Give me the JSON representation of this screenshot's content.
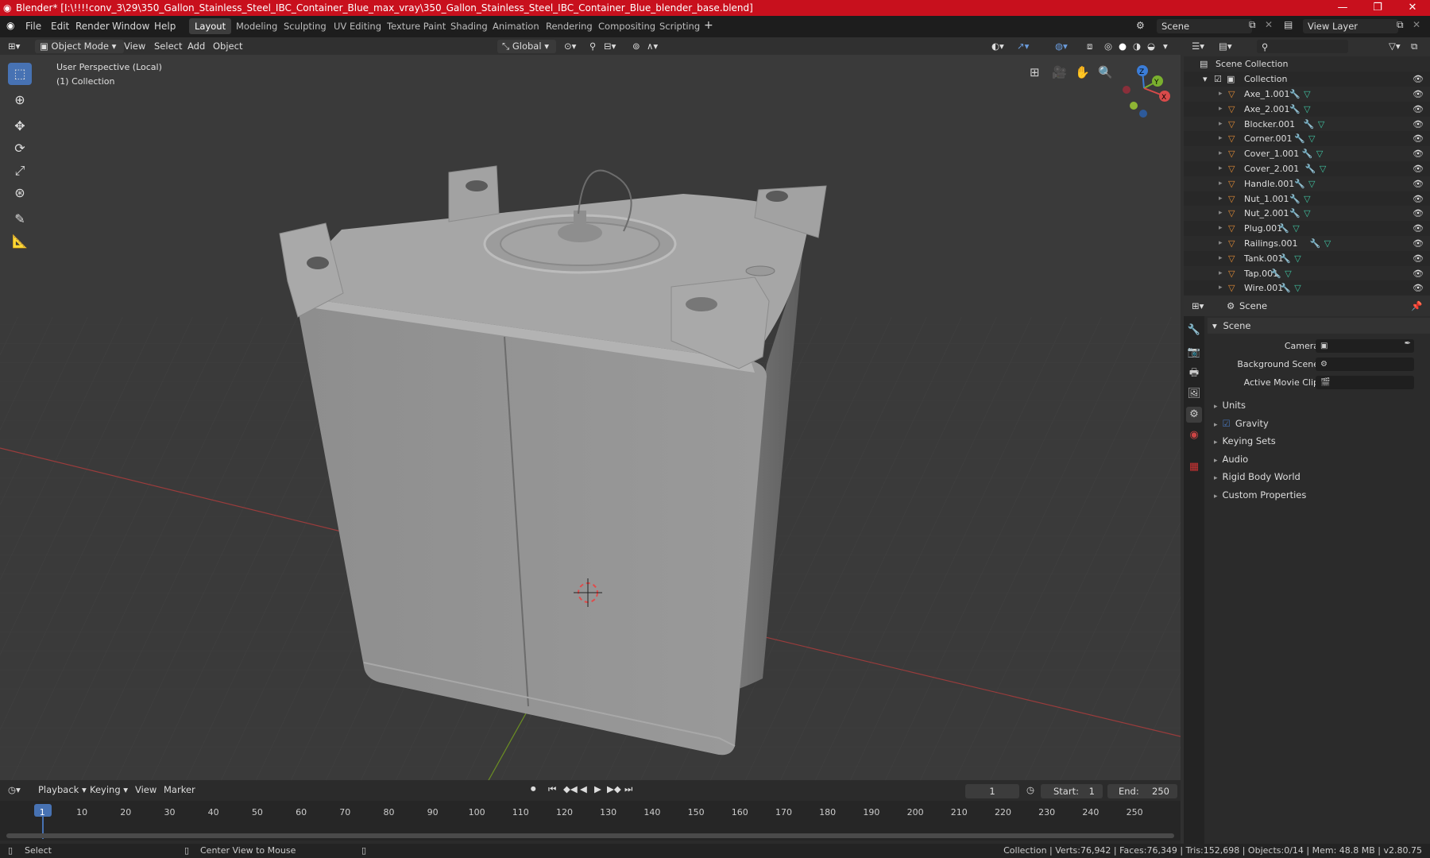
{
  "window": {
    "title": "Blender* [I:\\!!!!conv_3\\29\\350_Gallon_Stainless_Steel_IBC_Container_Blue_max_vray\\350_Gallon_Stainless_Steel_IBC_Container_Blue_blender_base.blend]",
    "minimize": "—",
    "maximize": "❐",
    "close": "✕"
  },
  "menu": {
    "file": "File",
    "edit": "Edit",
    "render": "Render",
    "window": "Window",
    "help": "Help"
  },
  "workspaces": [
    "Layout",
    "Modeling",
    "Sculpting",
    "UV Editing",
    "Texture Paint",
    "Shading",
    "Animation",
    "Rendering",
    "Compositing",
    "Scripting"
  ],
  "active_workspace": "Layout",
  "scene_field": "Scene",
  "view_layer_field": "View Layer",
  "viewport_header": {
    "mode": "Object Mode",
    "view": "View",
    "select": "Select",
    "add": "Add",
    "object": "Object",
    "orientation": "Global"
  },
  "viewport": {
    "perspective": "User Perspective (Local)",
    "collection": "(1) Collection",
    "gizmo": {
      "z": "Z",
      "y": "Y",
      "x": "X"
    }
  },
  "timeline": {
    "playback": "Playback",
    "keying": "Keying",
    "view": "View",
    "marker": "Marker",
    "current_frame": "1",
    "start_label": "Start:",
    "start": "1",
    "end_label": "End:",
    "end": "250",
    "ticks": [
      "1",
      "10",
      "20",
      "30",
      "40",
      "50",
      "60",
      "70",
      "80",
      "90",
      "100",
      "110",
      "120",
      "130",
      "140",
      "150",
      "160",
      "170",
      "180",
      "190",
      "200",
      "210",
      "220",
      "230",
      "240",
      "250"
    ]
  },
  "status": {
    "select": "Select",
    "center_view": "Center View to Mouse",
    "stats": "Collection | Verts:76,942 | Faces:76,349 | Tris:152,698 | Objects:0/14 | Mem: 48.8 MB | v2.80.75"
  },
  "outliner": {
    "root": "Scene Collection",
    "collection": "Collection",
    "items": [
      "Axe_1.001",
      "Axe_2.001",
      "Blocker.001",
      "Corner.001",
      "Cover_1.001",
      "Cover_2.001",
      "Handle.001",
      "Nut_1.001",
      "Nut_2.001",
      "Plug.001",
      "Railings.001",
      "Tank.001",
      "Tap.001",
      "Wire.001"
    ]
  },
  "properties": {
    "context": "Scene",
    "panel_title": "Scene",
    "camera_label": "Camera",
    "background_scene_label": "Background Scene",
    "active_movie_clip_label": "Active Movie Clip",
    "sections": [
      "Units",
      "Gravity",
      "Keying Sets",
      "Audio",
      "Rigid Body World",
      "Custom Properties"
    ]
  },
  "colors": {
    "titlebar": "#c8101d",
    "accent": "#4772b3",
    "object_icon": "#e08a35",
    "modifier_icon": "#6a9bdb",
    "mesh_icon": "#3fc2a0"
  }
}
